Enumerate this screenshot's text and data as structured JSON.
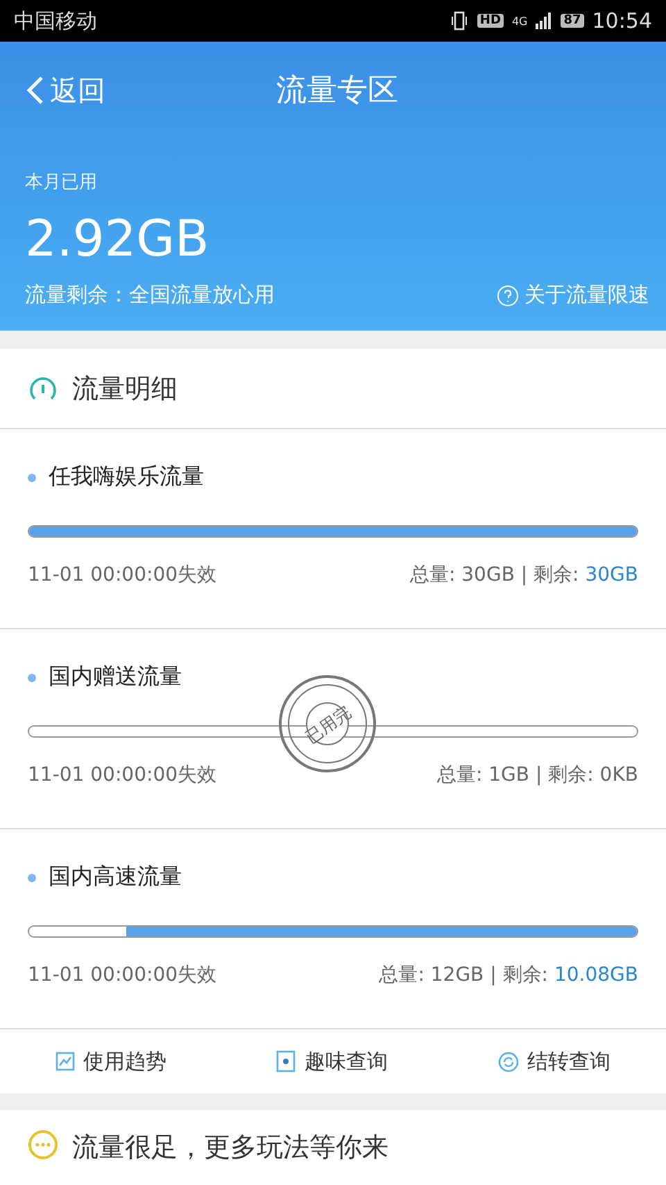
{
  "status_bar": {
    "carrier": "中国移动",
    "hd": "HD",
    "network": "4G",
    "battery": "87",
    "time": "10:54"
  },
  "header": {
    "back": "返回",
    "title": "流量专区",
    "used_label": "本月已用",
    "used_value": "2.92GB",
    "remaining_note": "流量剩余：全国流量放心用",
    "help_link": "关于流量限速"
  },
  "detail": {
    "title": "流量明细",
    "items": [
      {
        "name": "任我嗨娱乐流量",
        "level": 1,
        "expiry": "11-01 00:00:00失效",
        "total": "总量: 30GB",
        "separator": "|",
        "remaining_label": "剩余:",
        "remaining": "30GB",
        "used_up": false
      },
      {
        "name": "国内赠送流量",
        "level": 0,
        "expiry": "11-01 00:00:00失效",
        "total": "总量: 1GB",
        "separator": "|",
        "remaining_label": "剩余:",
        "remaining": "0KB",
        "used_up": true,
        "stamp": "已用完"
      },
      {
        "name": "国内高速流量",
        "level": 0.84,
        "expiry": "11-01 00:00:00失效",
        "total": "总量: 12GB",
        "separator": "|",
        "remaining_label": "剩余:",
        "remaining": "10.08GB",
        "used_up": false
      }
    ]
  },
  "actions": [
    {
      "kind": "trend",
      "label": "使用趋势"
    },
    {
      "kind": "fun",
      "label": "趣味查询"
    },
    {
      "kind": "carryover",
      "label": "结转查询"
    }
  ],
  "promo": {
    "text": "流量很足，更多玩法等你来"
  }
}
